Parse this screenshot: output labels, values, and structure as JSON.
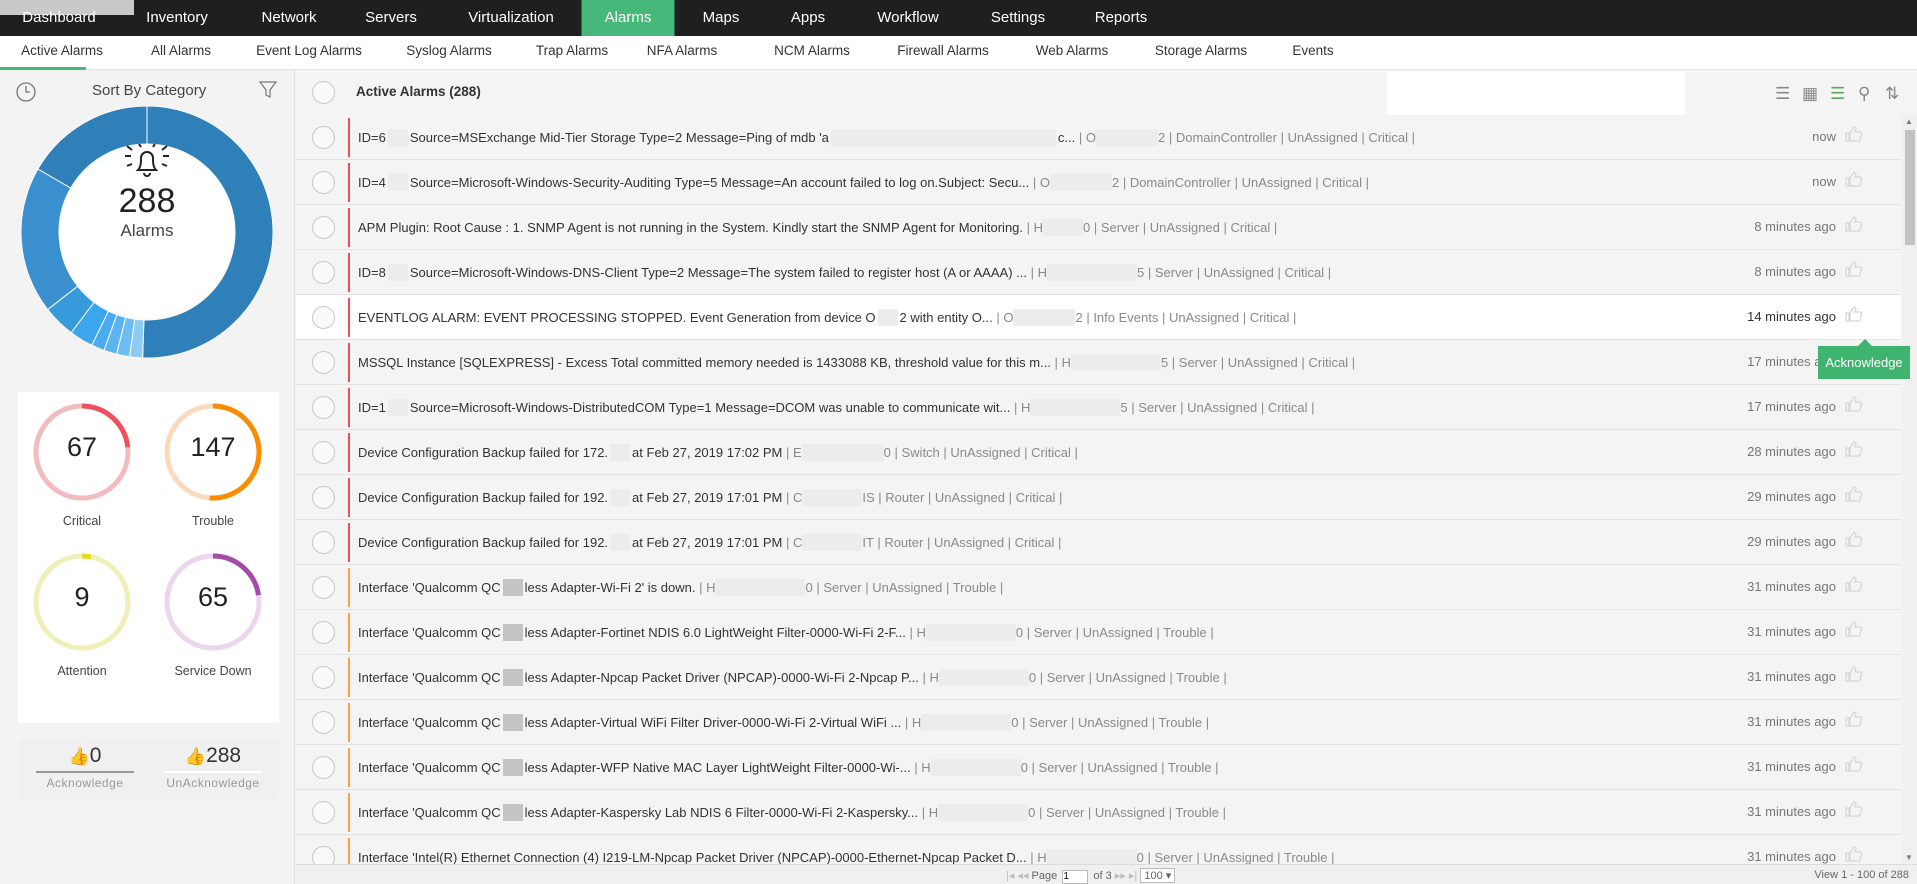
{
  "topnav": {
    "items": [
      "Dashboard",
      "Inventory",
      "Network",
      "Servers",
      "Virtualization",
      "Alarms",
      "Maps",
      "Apps",
      "Workflow",
      "Settings",
      "Reports"
    ],
    "active": "Alarms",
    "accent": "#45b87a"
  },
  "subnav": {
    "items": [
      "Active Alarms",
      "All Alarms",
      "Event Log Alarms",
      "Syslog Alarms",
      "Trap Alarms",
      "NFA Alarms",
      "NCM Alarms",
      "Firewall Alarms",
      "Web Alarms",
      "Storage Alarms",
      "Events"
    ],
    "active": "Active Alarms"
  },
  "sidebar": {
    "sort_label": "Sort By Category",
    "icons": [
      "clock-icon",
      "filter-icon",
      "bell-icon"
    ],
    "total": "288",
    "total_label": "Alarms",
    "severity": [
      {
        "label": "Critical",
        "value": 67,
        "color": "#f0505a",
        "track": "#f2bcbf"
      },
      {
        "label": "Trouble",
        "value": 147,
        "color": "#fb8c00",
        "track": "#fbd9bc"
      },
      {
        "label": "Attention",
        "value": 9,
        "color": "#e5dc1a",
        "track": "#f1efb9"
      },
      {
        "label": "Service Down",
        "value": 65,
        "color": "#a54aa8",
        "track": "#ecd6ee"
      }
    ],
    "acknowledge": {
      "value": "0",
      "label": "Acknowledge"
    },
    "unacknowledge": {
      "value": "288",
      "label": "UnAcknowledge"
    }
  },
  "main": {
    "title": "Active Alarms (288)",
    "toolbar_icons": [
      "list-view-icon",
      "table-view-icon",
      "severity-list-icon",
      "search-icon",
      "sort-icon"
    ],
    "tooltip": "Acknowledge",
    "severity_colors": {
      "Critical": "#e9505a",
      "Trouble": "#f5a24a"
    },
    "rows": [
      {
        "msg": [
          "ID=6",
          "Source=MSExchange Mid-Tier Storage Type=2 Message=Ping of mdb 'a",
          "c..."
        ],
        "dev": [
          "O",
          "2"
        ],
        "category": "DomainController",
        "owner": "UnAssigned",
        "severity": "Critical",
        "time": "now"
      },
      {
        "msg": [
          "ID=4",
          "Source=Microsoft-Windows-Security-Auditing Type=5 Message=An account failed to log on.Subject: Secu..."
        ],
        "dev": [
          "O",
          "2"
        ],
        "category": "DomainController",
        "owner": "UnAssigned",
        "severity": "Critical",
        "time": "now"
      },
      {
        "msg": [
          "APM Plugin: Root Cause : 1. SNMP Agent is not running in the System. Kindly start the SNMP Agent for Monitoring."
        ],
        "dev": [
          "H",
          "0"
        ],
        "category": "Server",
        "owner": "UnAssigned",
        "severity": "Critical",
        "time": "8 minutes ago"
      },
      {
        "msg": [
          "ID=8",
          "Source=Microsoft-Windows-DNS-Client Type=2 Message=The system failed to register host (A or AAAA) ..."
        ],
        "dev": [
          "H",
          "5"
        ],
        "category": "Server",
        "owner": "UnAssigned",
        "severity": "Critical",
        "time": "8 minutes ago"
      },
      {
        "msg": [
          "EVENTLOG ALARM: EVENT PROCESSING STOPPED. Event Generation from device O",
          "2 with entity O..."
        ],
        "dev": [
          "O",
          "2"
        ],
        "category": "Info Events",
        "owner": "UnAssigned",
        "severity": "Critical",
        "time": "14 minutes ago"
      },
      {
        "msg": [
          "MSSQL Instance [SQLEXPRESS] - Excess Total committed memory needed is 1433088 KB, threshold value for this m..."
        ],
        "dev": [
          "H",
          "5"
        ],
        "category": "Server",
        "owner": "UnAssigned",
        "severity": "Critical",
        "time": "17 minutes ago"
      },
      {
        "msg": [
          "ID=1",
          "Source=Microsoft-Windows-DistributedCOM Type=1 Message=DCOM was unable to communicate wit..."
        ],
        "dev": [
          "H",
          "5"
        ],
        "category": "Server",
        "owner": "UnAssigned",
        "severity": "Critical",
        "time": "17 minutes ago"
      },
      {
        "msg": [
          "Device Configuration Backup failed for 172.",
          "at Feb 27, 2019 17:02 PM"
        ],
        "dev": [
          "E",
          "0"
        ],
        "category": "Switch",
        "owner": "UnAssigned",
        "severity": "Critical",
        "time": "28 minutes ago"
      },
      {
        "msg": [
          "Device Configuration Backup failed for 192.",
          "at Feb 27, 2019 17:01 PM"
        ],
        "dev": [
          "C",
          "IS"
        ],
        "category": "Router",
        "owner": "UnAssigned",
        "severity": "Critical",
        "time": "29 minutes ago"
      },
      {
        "msg": [
          "Device Configuration Backup failed for 192.",
          "at Feb 27, 2019 17:01 PM"
        ],
        "dev": [
          "C",
          "IT"
        ],
        "category": "Router",
        "owner": "UnAssigned",
        "severity": "Critical",
        "time": "29 minutes ago"
      },
      {
        "msg": [
          "Interface 'Qualcomm QC",
          "less Adapter-Wi-Fi 2' is down."
        ],
        "dev": [
          "H",
          "0"
        ],
        "category": "Server",
        "owner": "UnAssigned",
        "severity": "Trouble",
        "time": "31 minutes ago"
      },
      {
        "msg": [
          "Interface 'Qualcomm QC",
          "less Adapter-Fortinet NDIS 6.0 LightWeight Filter-0000-Wi-Fi 2-F..."
        ],
        "dev": [
          "H",
          "0"
        ],
        "category": "Server",
        "owner": "UnAssigned",
        "severity": "Trouble",
        "time": "31 minutes ago"
      },
      {
        "msg": [
          "Interface 'Qualcomm QC",
          "less Adapter-Npcap Packet Driver (NPCAP)-0000-Wi-Fi 2-Npcap P..."
        ],
        "dev": [
          "H",
          "0"
        ],
        "category": "Server",
        "owner": "UnAssigned",
        "severity": "Trouble",
        "time": "31 minutes ago"
      },
      {
        "msg": [
          "Interface 'Qualcomm QC",
          "less Adapter-Virtual WiFi Filter Driver-0000-Wi-Fi 2-Virtual WiFi ..."
        ],
        "dev": [
          "H",
          "0"
        ],
        "category": "Server",
        "owner": "UnAssigned",
        "severity": "Trouble",
        "time": "31 minutes ago"
      },
      {
        "msg": [
          "Interface 'Qualcomm QC",
          "less Adapter-WFP Native MAC Layer LightWeight Filter-0000-Wi-..."
        ],
        "dev": [
          "H",
          "0"
        ],
        "category": "Server",
        "owner": "UnAssigned",
        "severity": "Trouble",
        "time": "31 minutes ago"
      },
      {
        "msg": [
          "Interface 'Qualcomm QC",
          "less Adapter-Kaspersky Lab NDIS 6 Filter-0000-Wi-Fi 2-Kaspersky..."
        ],
        "dev": [
          "H",
          "0"
        ],
        "category": "Server",
        "owner": "UnAssigned",
        "severity": "Trouble",
        "time": "31 minutes ago"
      },
      {
        "msg": [
          "Interface 'Intel(R) Ethernet Connection (4) I219-LM-Npcap Packet Driver (NPCAP)-0000-Ethernet-Npcap Packet D..."
        ],
        "dev": [
          "H",
          "0"
        ],
        "category": "Server",
        "owner": "UnAssigned",
        "severity": "Trouble",
        "time": "31 minutes ago"
      }
    ]
  },
  "footer": {
    "page_label": "Page",
    "page": "1",
    "of_label": "of 3",
    "page_size": "100",
    "view": "View 1 - 100 of 288"
  }
}
